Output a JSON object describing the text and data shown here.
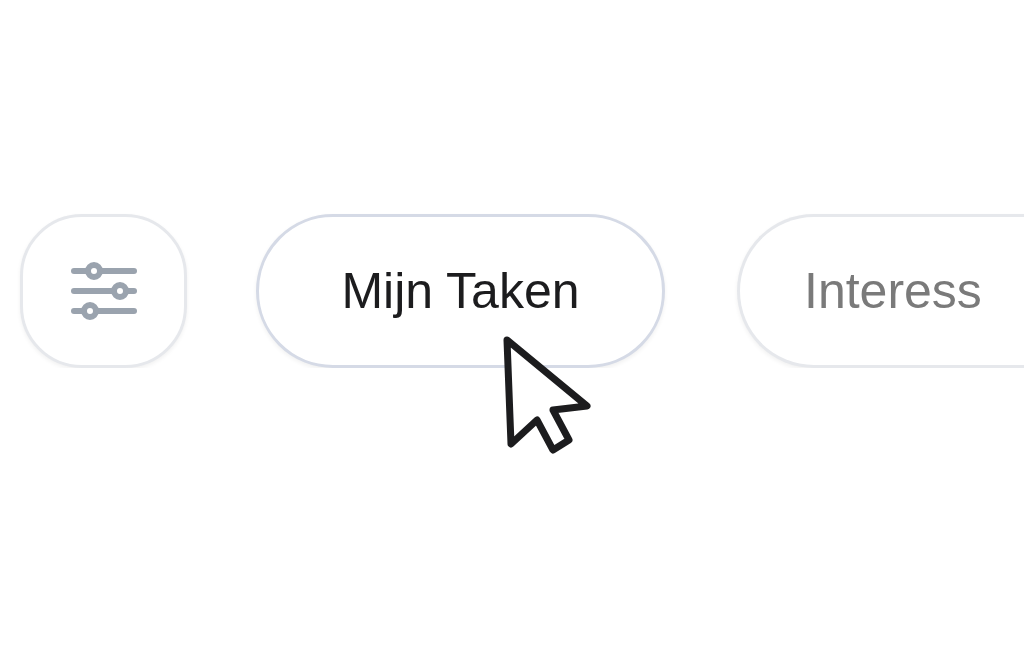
{
  "tabs": [
    {
      "kind": "filter",
      "selected": false,
      "hovered": false
    },
    {
      "kind": "label",
      "label": "Mijn Taken",
      "selected": true,
      "hovered": true
    },
    {
      "kind": "label",
      "label": "Interess",
      "selected": false,
      "hovered": false
    }
  ]
}
